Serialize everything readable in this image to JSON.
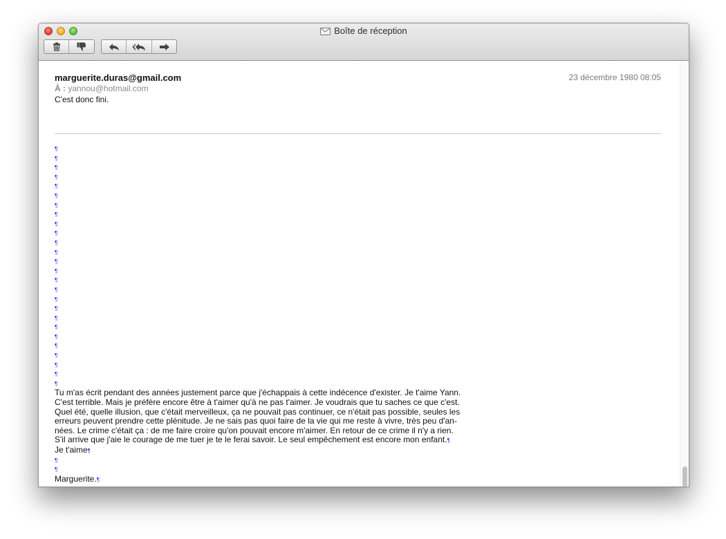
{
  "window": {
    "title": "Boîte de réception"
  },
  "toolbar": {
    "icons": [
      "trash-icon",
      "junk-thumbs-down-icon",
      "reply-icon",
      "reply-all-icon",
      "forward-icon"
    ]
  },
  "message": {
    "from": "marguerite.duras@gmail.com",
    "date": "23 décembre 1980 08:05",
    "to_label": "À :",
    "to_value": "yannou@hotmail.com",
    "subject": "C'est donc fini.",
    "empty_paragraph_marks": 26,
    "body_lines": [
      "Tu m'as écrit pendant des années justement parce que j'échappais à cette indécence d'exister. Je t'aime Yann.",
      "C'est terrible. Mais je préfère encore être à t'aimer qu'à ne pas t'aimer. Je voudrais que tu saches ce que c'est.",
      "Quel été, quelle illusion, que c'était merveilleux, ça ne pouvait pas continuer, ce n'était pas possible, seules les",
      "erreurs peuvent prendre cette plénitude. Je ne sais pas quoi faire de la vie qui me reste à vivre, très peu d'an-",
      "nées. Le crime c'était ça : de me faire croire qu'on pouvait encore m'aimer. En retour de ce crime il n'y a rien.",
      "S'il arrive que j'aie le courage de me tuer je te le ferai savoir. Le seul empêchement est encore mon enfant."
    ],
    "closing_1": "Je t'aime",
    "signature": "Marguerite."
  },
  "colors": {
    "pilcrow": "#1a1aff"
  }
}
